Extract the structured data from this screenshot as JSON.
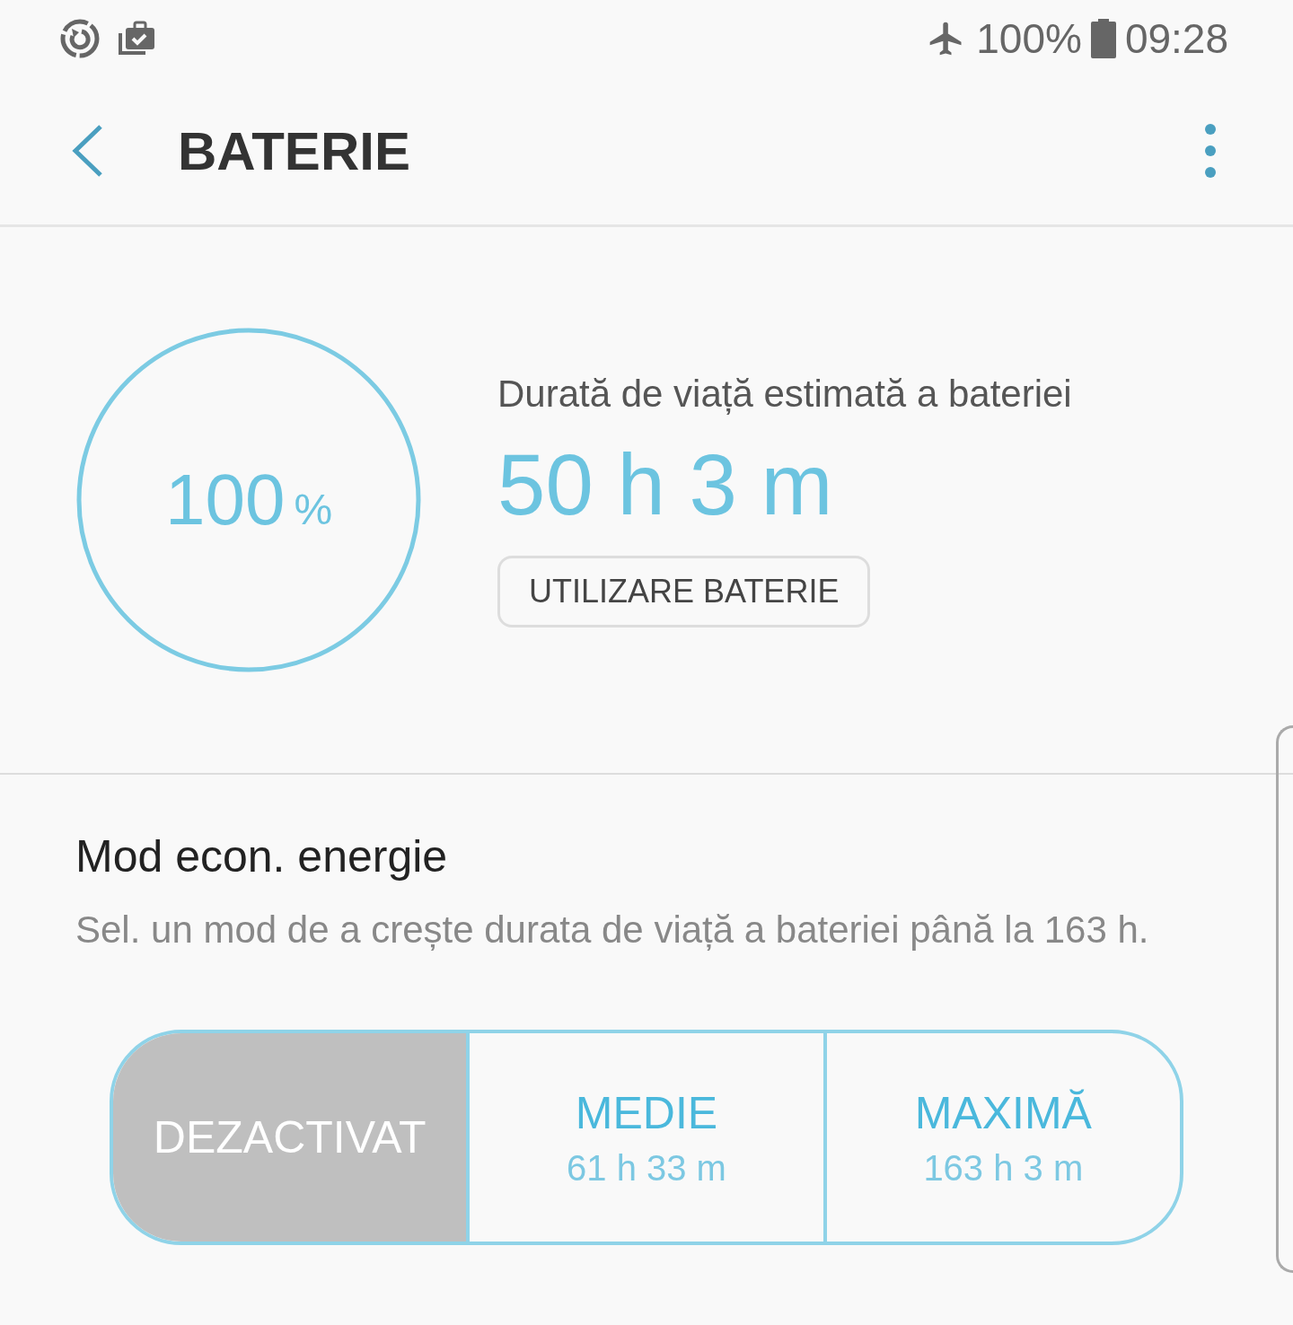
{
  "status_bar": {
    "battery": "100%",
    "time": "09:28"
  },
  "app_bar": {
    "title": "BATERIE"
  },
  "battery": {
    "percent": "100",
    "unit": "%",
    "level": 1,
    "estimate_label": "Durată de viață estimată a bateriei",
    "estimate": "50 h 3 m",
    "usage_button": "UTILIZARE BATERIE"
  },
  "power_saving": {
    "title": "Mod econ. energie",
    "description": "Sel. un mod de a crește durata de viață a bateriei până la 163 h.",
    "modes": [
      {
        "label": "DEZACTIVAT",
        "selected": true
      },
      {
        "label": "MEDIE",
        "time": "61 h 33 m",
        "selected": false
      },
      {
        "label": "MAXIMĂ",
        "time": "163 h 3 m",
        "selected": false
      }
    ]
  }
}
